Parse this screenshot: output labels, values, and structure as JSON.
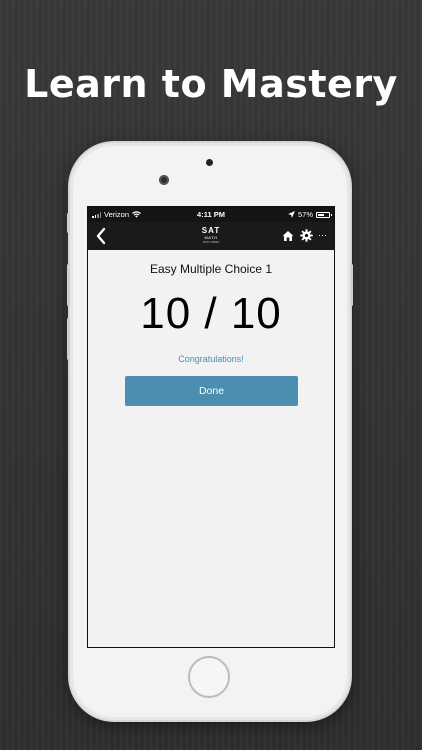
{
  "headline": "Learn to Mastery",
  "status_bar": {
    "carrier": "Verizon",
    "time": "4:11 PM",
    "battery": "57%",
    "battery_level": 0.57
  },
  "nav": {
    "back_icon": "chevron-left-icon",
    "logo_main": "SAT",
    "logo_sub": "MATH",
    "logo_tag": "TEST PREP",
    "home_icon": "home-icon",
    "settings_icon": "gear-icon",
    "more_icon": "ellipsis-icon",
    "more_glyph": "···"
  },
  "quiz": {
    "title": "Easy Multiple Choice 1",
    "score": "10 / 10",
    "message": "Congratulations!",
    "done_label": "Done"
  },
  "colors": {
    "accent": "#4b8eaf",
    "message": "#4a8fb4",
    "navbar": "#1a1a1a",
    "background": "#333333"
  }
}
